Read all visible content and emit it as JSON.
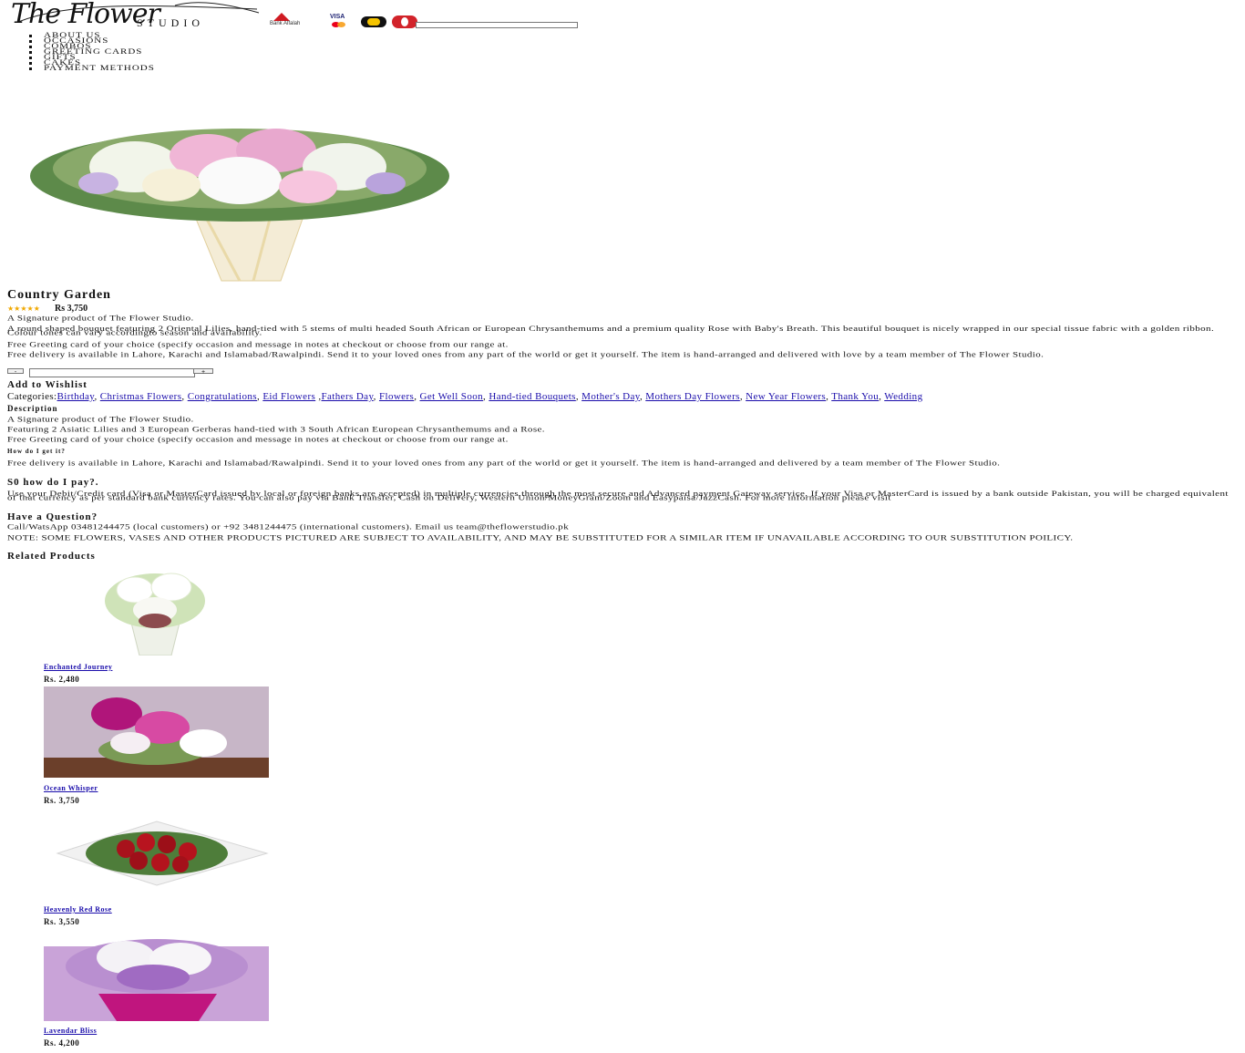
{
  "header": {
    "logo_script": "The Flower",
    "logo_studio": "STUDIO",
    "bank_label": "Bank Alfalah",
    "visa_label": "VISA",
    "search_placeholder": ""
  },
  "nav": {
    "items": [
      {
        "label": "ABOUT US"
      },
      {
        "label": "OCCASIONS"
      },
      {
        "label": "COMBOS"
      },
      {
        "label": "GREETING CARDS"
      },
      {
        "label": "GIFTS"
      },
      {
        "label": "CAKES"
      },
      {
        "label": "PAYMENT METHODS"
      }
    ]
  },
  "product": {
    "title": "Country Garden",
    "stars": "★★★★★",
    "price": "Rs 3,750",
    "signature": "A Signature product of The Flower Studio.",
    "description": "A round shaped bouquet featuring 2 Oriental Lilies, hand-tied with 5 stems of multi headed South African or European Chrysanthemums and a premium quality Rose with Baby's Breath. This beautiful bouquet is nicely wrapped in our special tissue fabric with a golden ribbon. Colour tones can vary accordingto season and availability.",
    "greeting": "Free Greeting card of your choice (specify occasion and message in notes at checkout or choose from our range at.",
    "delivery": "Free delivery is available in Lahore, Karachi and Islamabad/Rawalpindi. Send it to your loved ones from any part of the world or get it yourself. The item is hand-arranged and delivered with love by a team member of The Flower Studio.",
    "qty_minus": "-",
    "qty_plus": "+",
    "qty_value": "",
    "wishlist": "Add to Wishlist",
    "categories_label": "Categories:",
    "categories": [
      {
        "label": "Birthday"
      },
      {
        "label": "Christmas Flowers"
      },
      {
        "label": "Congratulations"
      },
      {
        "label": "Eid Flowers"
      },
      {
        "label": "Fathers Day"
      },
      {
        "label": "Flowers"
      },
      {
        "label": "Get Well Soon"
      },
      {
        "label": "Hand-tied Bouquets"
      },
      {
        "label": "Mother's Day"
      },
      {
        "label": "Mothers Day Flowers"
      },
      {
        "label": "New Year Flowers"
      },
      {
        "label": "Thank You"
      },
      {
        "label": "Wedding"
      }
    ]
  },
  "description_tab": {
    "heading": "Description",
    "signature": "A Signature product of The Flower Studio.",
    "featuring": "Featuring 2 Asiatic Lilies and 3 European Gerberas hand-tied with 3 South African European Chrysanthemums and a Rose.",
    "greeting": "Free Greeting card of your choice (specify occasion and message in notes at checkout or choose from our range at.",
    "how_heading": "How do I get it?",
    "delivery": "Free delivery is available in Lahore, Karachi and Islamabad/Rawalpindi. Send it to your loved ones from any part of the world or get it yourself. The item is hand-arranged and delivered by a team member of The Flower Studio.",
    "pay_heading": "S0 how do I pay?.",
    "pay_text": "Use your Debit/Credit card (Visa or MasterCard issued by local or foreign banks are accepted) in multiple currencies through the most secure and Advanced payment Gateway service. If your Visa or MasterCard is issued by a bank outside Pakistan, you will be charged equivalent of that currency as per standard bank currency rates. You can also pay via Bank Transfer, Cash on Delivery, Western Union/MoneyGram/Zoom and Easypaisa/JazzCash. For more information please visit",
    "question_heading": "Have a Question?",
    "contact": "Call/WatsApp 03481244475 (local customers) or +92 3481244475 (international customers). Email us team@theflowerstudio.pk",
    "note": "NOTE: SOME FLOWERS, VASES AND OTHER PRODUCTS PICTURED ARE SUBJECT TO AVAILABILITY, AND MAY BE SUBSTITUTED FOR A SIMILAR ITEM IF UNAVAILABLE ACCORDING TO OUR SUBSTITUTION POILICY."
  },
  "related": {
    "heading": "Related Products",
    "items": [
      {
        "name": "Enchanted Journey",
        "price": "Rs. 2,480"
      },
      {
        "name": "Ocean Whisper",
        "price": "Rs. 3,750"
      },
      {
        "name": "Heavenly Red Rose",
        "price": "Rs. 3,550"
      },
      {
        "name": "Lavendar Bliss",
        "price": "Rs. 4,200"
      }
    ]
  }
}
